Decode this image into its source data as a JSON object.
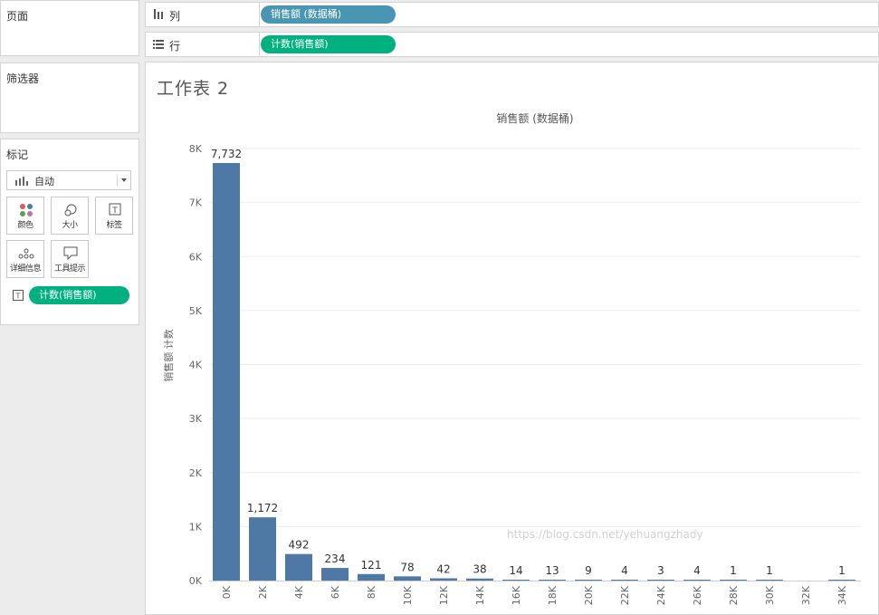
{
  "panels": {
    "pages": "页面",
    "filters": "筛选器",
    "marks": "标记"
  },
  "marks": {
    "type": "自动",
    "cards": {
      "color": "颜色",
      "size": "大小",
      "label": "标签",
      "detail": "详细信息",
      "tooltip": "工具提示"
    },
    "label_pill": "计数(销售额)"
  },
  "shelves": {
    "columns_label": "列",
    "columns_pill": "销售额 (数据桶)",
    "rows_label": "行",
    "rows_pill": "计数(销售额)"
  },
  "sheet": {
    "title": "工作表 2"
  },
  "watermark": "https://blog.csdn.net/yehuangzhady",
  "colors": {
    "bar": "#4e79a7",
    "pill_green": "#00b180",
    "pill_blue": "#4996b2"
  },
  "chart_data": {
    "type": "bar",
    "title": "销售额 (数据桶)",
    "ylabel": "销售额 计数",
    "categories": [
      "0K",
      "2K",
      "4K",
      "6K",
      "8K",
      "10K",
      "12K",
      "14K",
      "16K",
      "18K",
      "20K",
      "22K",
      "24K",
      "26K",
      "28K",
      "30K",
      "32K",
      "34K"
    ],
    "values": [
      7732,
      1172,
      492,
      234,
      121,
      78,
      42,
      38,
      14,
      13,
      9,
      4,
      3,
      4,
      1,
      1,
      null,
      1
    ],
    "data_labels": [
      "7,732",
      "1,172",
      "492",
      "234",
      "121",
      "78",
      "42",
      "38",
      "14",
      "13",
      "9",
      "4",
      "3",
      "4",
      "1",
      "1",
      "",
      "1"
    ],
    "yticks": [
      0,
      1000,
      2000,
      3000,
      4000,
      5000,
      6000,
      7000,
      8000
    ],
    "ytick_labels": [
      "0K",
      "1K",
      "2K",
      "3K",
      "4K",
      "5K",
      "6K",
      "7K",
      "8K"
    ],
    "ylim": [
      0,
      8000
    ],
    "grid": true
  }
}
